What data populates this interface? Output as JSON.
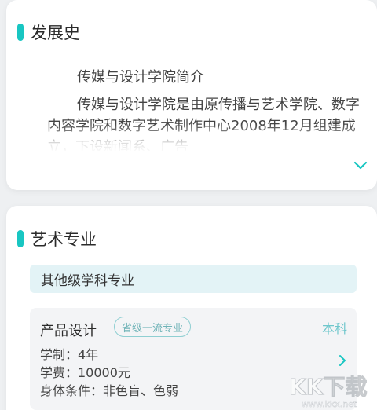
{
  "history": {
    "title": "发展史",
    "intro_title": "传媒与设计学院简介",
    "intro_text": "传媒与设计学院是由原传播与艺术学院、数字内容学院和数字艺术制作中心2008年12月组建成立，下设新闻系、广告",
    "expand_icon": "chevron-down-icon"
  },
  "majors": {
    "title": "艺术专业",
    "category": "其他级学科专业",
    "items": [
      {
        "name": "产品设计",
        "tag": "省级一流专业",
        "level": "本科",
        "duration": "学制：4年",
        "tuition": "学费：10000元",
        "requirement": "身体条件：非色盲、色弱",
        "arrow_icon": "chevron-right-icon"
      }
    ]
  },
  "watermark": {
    "brand": "KK下载",
    "url": "www.kkx.net"
  },
  "colors": {
    "accent": "#18c6c2",
    "category_bg": "#e3f3f6",
    "item_bg": "#f3f4f6",
    "page_bg": "#eef0f2"
  }
}
